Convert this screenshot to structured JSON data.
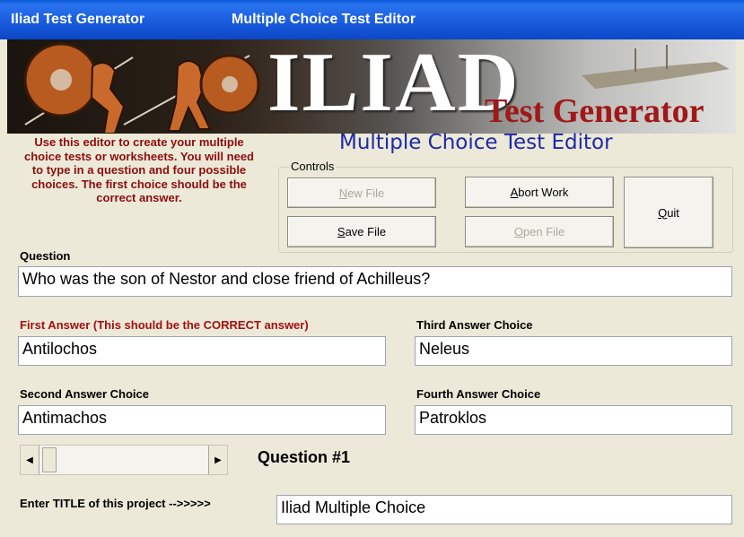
{
  "titlebar": {
    "app_title": "Iliad Test Generator",
    "window_title": "Multiple Choice Test Editor"
  },
  "banner": {
    "title": "ILIAD",
    "subtitle": "Test Generator"
  },
  "editor_title": "Multiple Choice Test Editor",
  "instructions": "Use this editor to create your multiple choice tests or worksheets. You will need to type in a question and four possible choices. The first choice should be the correct answer.",
  "controls": {
    "legend": "Controls",
    "new_file": {
      "mnemonic": "N",
      "rest": "ew File",
      "enabled": false
    },
    "save_file": {
      "mnemonic": "S",
      "rest": "ave File",
      "enabled": true
    },
    "abort_work": {
      "mnemonic": "A",
      "rest": "bort Work",
      "enabled": true
    },
    "open_file": {
      "mnemonic": "O",
      "rest": "pen File",
      "enabled": false
    },
    "quit": {
      "mnemonic": "Q",
      "rest": "uit",
      "enabled": true
    }
  },
  "question": {
    "label": "Question",
    "value": "Who was the son of Nestor and close friend of Achilleus?"
  },
  "answers": {
    "first": {
      "label": "First Answer (This should be the CORRECT answer)",
      "value": "Antilochos"
    },
    "second": {
      "label": "Second Answer Choice",
      "value": "Antimachos"
    },
    "third": {
      "label": "Third Answer Choice",
      "value": "Neleus"
    },
    "fourth": {
      "label": "Fourth Answer Choice",
      "value": "Patroklos"
    }
  },
  "navigator": {
    "question_label": "Question #1"
  },
  "project": {
    "label": "Enter TITLE of this project -->>>>>",
    "value": "Iliad Multiple Choice"
  },
  "colors": {
    "titlebar": "#1c5fe0",
    "instructions": "#8b0d0d",
    "editor_title": "#1c2aa6",
    "banner_subtitle": "#a01818",
    "window_bg": "#ece9d8"
  }
}
